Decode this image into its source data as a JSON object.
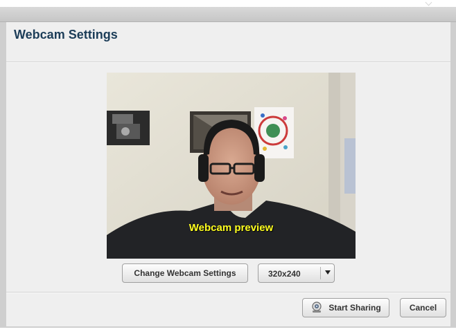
{
  "dialog": {
    "title": "Webcam Settings"
  },
  "preview": {
    "label": "Webcam preview"
  },
  "controls": {
    "change_settings_label": "Change Webcam Settings",
    "resolution": {
      "selected": "320x240"
    }
  },
  "footer": {
    "start_sharing_label": "Start Sharing",
    "cancel_label": "Cancel"
  },
  "icons": {
    "resolution_dropdown": "chevron-down-icon",
    "start_sharing": "webcam-icon"
  },
  "colors": {
    "title": "#1c3d58",
    "preview_label": "#ffff1f"
  }
}
